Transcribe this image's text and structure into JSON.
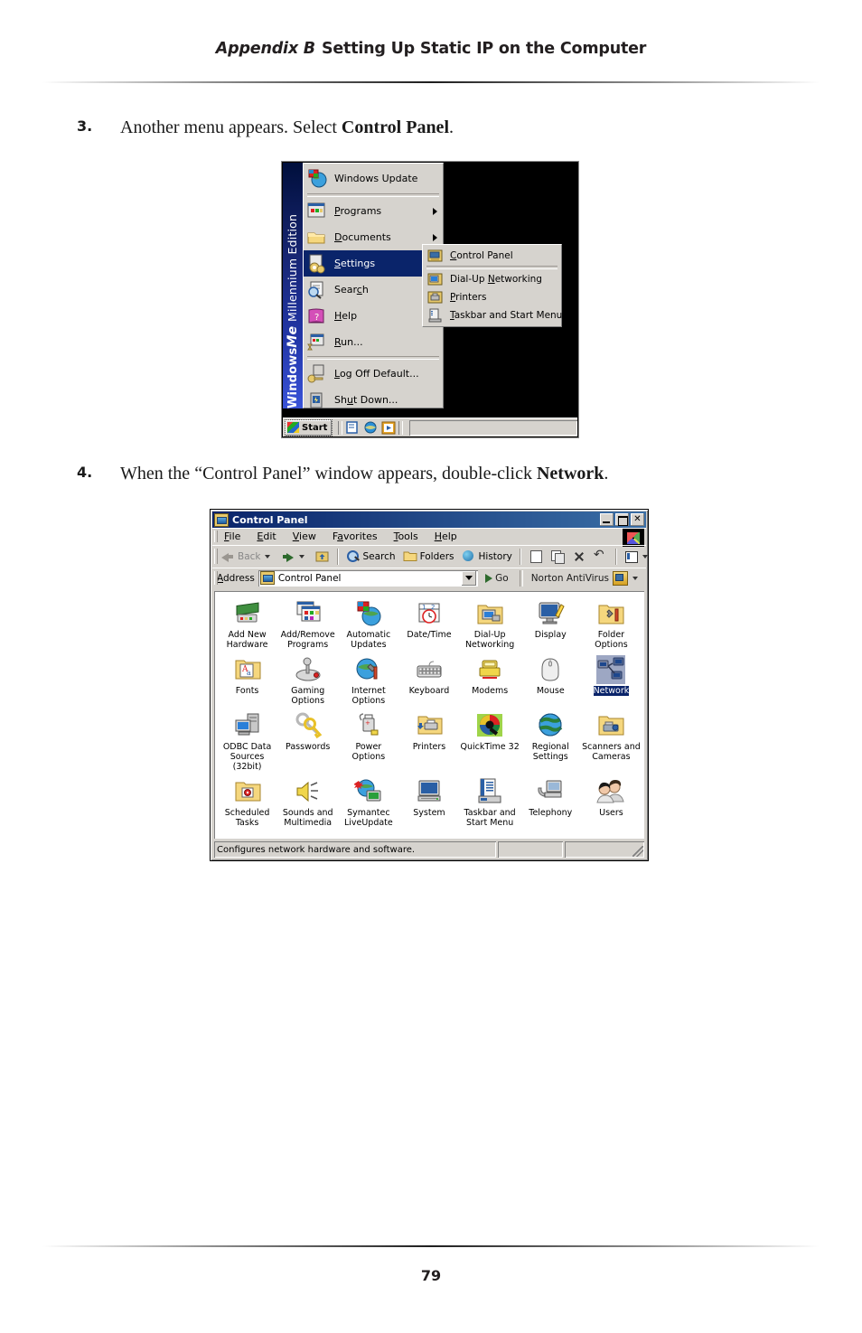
{
  "page": {
    "header_appendix": "Appendix B",
    "header_title": "Setting Up Static IP on the Computer",
    "page_number": "79"
  },
  "steps": [
    {
      "number": "3.",
      "text_before": "Another menu appears. Select ",
      "text_bold": "Control Panel",
      "text_after": "."
    },
    {
      "number": "4.",
      "text_before": "When the “Control Panel” window appears, double-click ",
      "text_bold": "Network",
      "text_after": "."
    }
  ],
  "start_menu": {
    "banner_brand": "Windows",
    "banner_me": "Me",
    "banner_edition": "Millennium Edition",
    "items": [
      {
        "label": "Windows Update",
        "icon": "windows-update-icon",
        "arrow": false,
        "selected": false,
        "separator_after": true
      },
      {
        "label": "Programs",
        "accel": "P",
        "icon": "programs-icon",
        "arrow": true,
        "selected": false,
        "separator_after": false
      },
      {
        "label": "Documents",
        "accel": "D",
        "icon": "documents-folder-icon",
        "arrow": true,
        "selected": false,
        "separator_after": false
      },
      {
        "label": "Settings",
        "accel": "S",
        "icon": "settings-gear-icon",
        "arrow": true,
        "selected": true,
        "separator_after": false
      },
      {
        "label": "Search",
        "accel": "c",
        "icon": "search-magnifier-icon",
        "arrow": true,
        "selected": false,
        "separator_after": false
      },
      {
        "label": "Help",
        "accel": "H",
        "icon": "help-book-icon",
        "arrow": false,
        "selected": false,
        "separator_after": false
      },
      {
        "label": "Run...",
        "accel": "R",
        "icon": "run-icon",
        "arrow": false,
        "selected": false,
        "separator_after": true
      },
      {
        "label": "Log Off Default...",
        "accel": "L",
        "icon": "log-off-key-icon",
        "arrow": false,
        "selected": false,
        "separator_after": false
      },
      {
        "label": "Shut Down...",
        "accel": "u",
        "icon": "shut-down-icon",
        "arrow": false,
        "selected": false,
        "separator_after": false
      }
    ],
    "submenu": [
      {
        "label": "Control Panel",
        "accel": "C",
        "icon": "control-panel-icon",
        "separator_after": true
      },
      {
        "label": "Dial-Up Networking",
        "accel": "N",
        "icon": "dial-up-networking-icon",
        "separator_after": false
      },
      {
        "label": "Printers",
        "accel": "P",
        "icon": "printers-icon",
        "separator_after": false
      },
      {
        "label": "Taskbar and Start Menu",
        "accel": "T",
        "icon": "taskbar-start-menu-icon",
        "separator_after": false
      }
    ],
    "taskbar": {
      "start_label": "Start",
      "quick_launch": [
        "show-desktop-icon",
        "internet-explorer-icon",
        "media-player-icon"
      ]
    }
  },
  "control_panel": {
    "window_title": "Control Panel",
    "window_buttons": [
      "minimize-button",
      "maximize-button",
      "close-button"
    ],
    "menus": [
      {
        "label": "File",
        "accel": "F"
      },
      {
        "label": "Edit",
        "accel": "E"
      },
      {
        "label": "View",
        "accel": "V"
      },
      {
        "label": "Favorites",
        "accel": "a"
      },
      {
        "label": "Tools",
        "accel": "T"
      },
      {
        "label": "Help",
        "accel": "H"
      }
    ],
    "toolbar": [
      {
        "label": "Back",
        "icon": "back-arrow-icon",
        "disabled": true,
        "caret": true
      },
      {
        "label": "",
        "icon": "forward-arrow-icon",
        "disabled": true,
        "caret": true
      },
      {
        "label": "",
        "icon": "up-one-level-icon",
        "disabled": false,
        "caret": false
      },
      {
        "label": "Search",
        "icon": "search-icon",
        "disabled": false,
        "caret": false
      },
      {
        "label": "Folders",
        "icon": "folders-icon",
        "disabled": false,
        "caret": false
      },
      {
        "label": "History",
        "icon": "history-icon",
        "disabled": false,
        "caret": false
      },
      {
        "label": "",
        "icon": "move-to-icon",
        "disabled": false,
        "caret": false
      },
      {
        "label": "",
        "icon": "copy-to-icon",
        "disabled": false,
        "caret": false
      },
      {
        "label": "",
        "icon": "delete-icon",
        "disabled": false,
        "caret": false
      },
      {
        "label": "",
        "icon": "undo-icon",
        "disabled": false,
        "caret": false
      },
      {
        "label": "",
        "icon": "views-icon",
        "disabled": false,
        "caret": true
      }
    ],
    "address_bar": {
      "label": "Address",
      "value": "Control Panel",
      "go_label": "Go",
      "norton_label": "Norton AntiVirus"
    },
    "icons": [
      {
        "label": "Add New\nHardware",
        "icon": "add-new-hardware-icon",
        "selected": false
      },
      {
        "label": "Add/Remove\nPrograms",
        "icon": "add-remove-programs-icon",
        "selected": false
      },
      {
        "label": "Automatic\nUpdates",
        "icon": "automatic-updates-icon",
        "selected": false
      },
      {
        "label": "Date/Time",
        "icon": "date-time-icon",
        "selected": false
      },
      {
        "label": "Dial-Up\nNetworking",
        "icon": "dial-up-networking-icon",
        "selected": false
      },
      {
        "label": "Display",
        "icon": "display-icon",
        "selected": false
      },
      {
        "label": "Folder Options",
        "icon": "folder-options-icon",
        "selected": false
      },
      {
        "label": "Fonts",
        "icon": "fonts-icon",
        "selected": false
      },
      {
        "label": "Gaming\nOptions",
        "icon": "gaming-options-icon",
        "selected": false
      },
      {
        "label": "Internet\nOptions",
        "icon": "internet-options-icon",
        "selected": false
      },
      {
        "label": "Keyboard",
        "icon": "keyboard-icon",
        "selected": false
      },
      {
        "label": "Modems",
        "icon": "modems-icon",
        "selected": false
      },
      {
        "label": "Mouse",
        "icon": "mouse-icon",
        "selected": false
      },
      {
        "label": "Network",
        "icon": "network-icon",
        "selected": true
      },
      {
        "label": "ODBC Data\nSources (32bit)",
        "icon": "odbc-data-sources-icon",
        "selected": false
      },
      {
        "label": "Passwords",
        "icon": "passwords-icon",
        "selected": false
      },
      {
        "label": "Power Options",
        "icon": "power-options-icon",
        "selected": false
      },
      {
        "label": "Printers",
        "icon": "printers-icon",
        "selected": false
      },
      {
        "label": "QuickTime 32",
        "icon": "quicktime-32-icon",
        "selected": false
      },
      {
        "label": "Regional\nSettings",
        "icon": "regional-settings-icon",
        "selected": false
      },
      {
        "label": "Scanners and\nCameras",
        "icon": "scanners-cameras-icon",
        "selected": false
      },
      {
        "label": "Scheduled\nTasks",
        "icon": "scheduled-tasks-icon",
        "selected": false
      },
      {
        "label": "Sounds and\nMultimedia",
        "icon": "sounds-multimedia-icon",
        "selected": false
      },
      {
        "label": "Symantec\nLiveUpdate",
        "icon": "symantec-liveupdate-icon",
        "selected": false
      },
      {
        "label": "System",
        "icon": "system-icon",
        "selected": false
      },
      {
        "label": "Taskbar and\nStart Menu",
        "icon": "taskbar-start-menu-icon",
        "selected": false
      },
      {
        "label": "Telephony",
        "icon": "telephony-icon",
        "selected": false
      },
      {
        "label": "Users",
        "icon": "users-icon",
        "selected": false
      }
    ],
    "status_bar": {
      "message": "Configures network hardware and software.",
      "panel2": "",
      "panel3": ""
    }
  },
  "colors": {
    "titlebar_start": "#0a246a",
    "titlebar_end": "#3a6ea5",
    "selection": "#0a246a",
    "window_face": "#d6d3ce",
    "text": "#231f20"
  }
}
